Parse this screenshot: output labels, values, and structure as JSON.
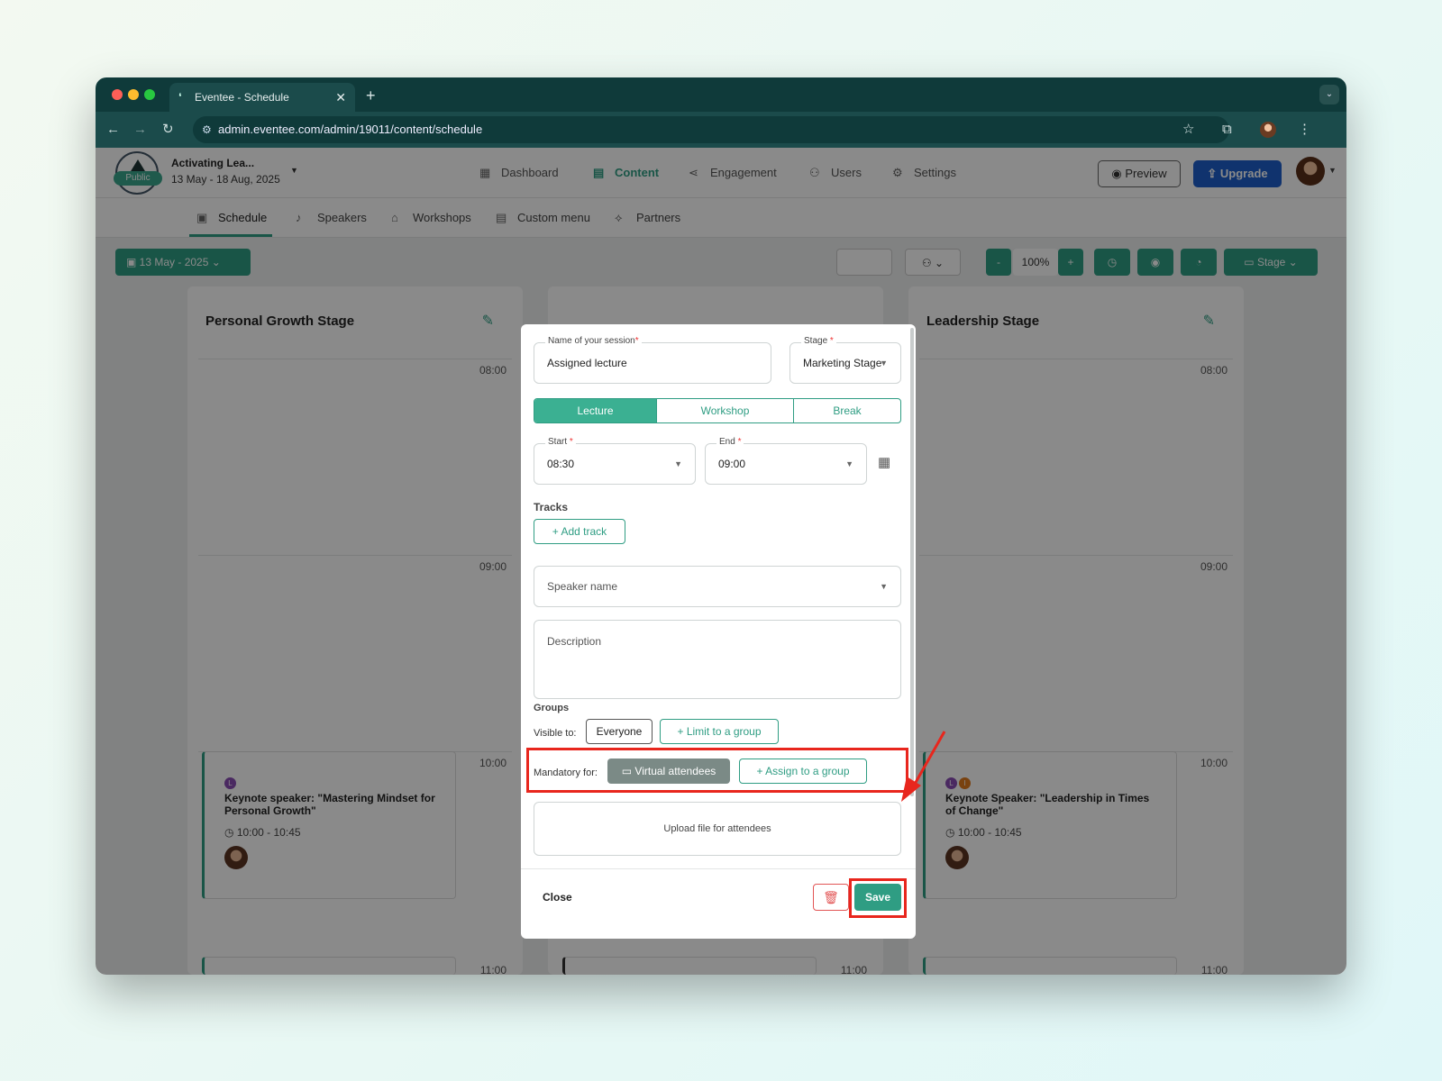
{
  "browser": {
    "tab_title": "Eventee - Schedule",
    "url": "admin.eventee.com/admin/19011/content/schedule"
  },
  "app": {
    "event_name": "Activating Lea...",
    "event_dates": "13 May - 18 Aug, 2025",
    "public_badge": "Public",
    "nav": [
      {
        "label": "Dashboard",
        "icon": "dashboard-icon"
      },
      {
        "label": "Content",
        "icon": "content-icon",
        "active": true
      },
      {
        "label": "Engagement",
        "icon": "share-icon"
      },
      {
        "label": "Users",
        "icon": "users-icon"
      },
      {
        "label": "Settings",
        "icon": "gear-icon"
      }
    ],
    "preview_label": "Preview",
    "upgrade_label": "Upgrade",
    "subnav": [
      {
        "label": "Schedule",
        "icon": "calendar-icon",
        "active": true
      },
      {
        "label": "Speakers",
        "icon": "microphone-icon"
      },
      {
        "label": "Workshops",
        "icon": "graduation-cap-icon"
      },
      {
        "label": "Custom menu",
        "icon": "menu-doc-icon"
      },
      {
        "label": "Partners",
        "icon": "handshake-icon"
      }
    ]
  },
  "schedule": {
    "date_selector": "13 May - 2025",
    "zoom": "100%",
    "zoom_minus": "-",
    "zoom_plus": "+",
    "stage_filter": "Stage",
    "columns": [
      {
        "title": "Personal Growth Stage",
        "times": [
          "08:00",
          "09:00",
          "10:00",
          "11:00"
        ],
        "card_title": "Keynote speaker: \"Mastering Mindset for Personal Growth\"",
        "card_time": "10:00 - 10:45",
        "badges": [
          "L"
        ]
      },
      {
        "title": "Leadership Stage",
        "times": [
          "08:00",
          "09:00",
          "10:00",
          "11:00"
        ],
        "card_title": "Keynote Speaker: \"Leadership in Times of Change\"",
        "card_time": "10:00 - 10:45",
        "badges": [
          "L",
          "I"
        ]
      }
    ],
    "middle_column_time": "11:00"
  },
  "modal": {
    "session_name_label": "Name of your session",
    "session_name_value": "Assigned lecture",
    "stage_label": "Stage",
    "stage_value": "Marketing Stage",
    "types": [
      "Lecture",
      "Workshop",
      "Break"
    ],
    "active_type": "Lecture",
    "start_label": "Start",
    "start_value": "08:30",
    "end_label": "End",
    "end_value": "09:00",
    "tracks_label": "Tracks",
    "add_track_label": "Add track",
    "speaker_placeholder": "Speaker name",
    "description_placeholder": "Description",
    "groups_label": "Groups",
    "visible_to_label": "Visible to:",
    "visible_to_value": "Everyone",
    "limit_group_label": "Limit to a group",
    "mandatory_label": "Mandatory for:",
    "mandatory_value": "Virtual attendees",
    "assign_group_label": "Assign to a group",
    "upload_label": "Upload file for attendees",
    "close_label": "Close",
    "save_label": "Save"
  },
  "colors": {
    "accent": "#2f9d83",
    "upgrade": "#1f5fcb",
    "highlight": "#e8261d",
    "browser_chrome": "#0f3a3a"
  }
}
